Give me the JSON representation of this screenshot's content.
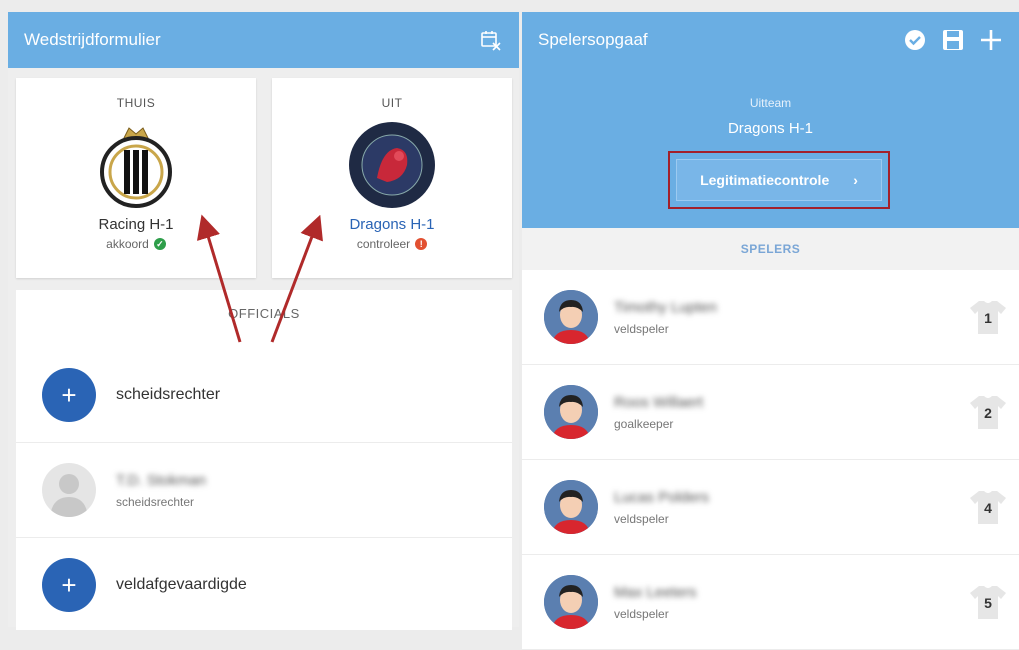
{
  "left_panel": {
    "title": "Wedstrijdformulier",
    "home": {
      "side": "THUIS",
      "name": "Racing H-1",
      "status": "akkoord",
      "status_color": "#2e9e4a"
    },
    "away": {
      "side": "UIT",
      "name": "Dragons H-1",
      "status": "controleer",
      "status_color": "#e25031"
    },
    "officials_title": "OFFICIALS",
    "officials": [
      {
        "type": "add",
        "label": "scheidsrechter"
      },
      {
        "type": "person",
        "name": "T.D. Stokman",
        "role": "scheidsrechter"
      },
      {
        "type": "add",
        "label": "veldafgevaardigde"
      }
    ]
  },
  "right_panel": {
    "title": "Spelersopgaaf",
    "uitteam_label": "Uitteam",
    "team": "Dragons H-1",
    "button_label": "Legitimatiecontrole",
    "button_chevron": "›",
    "spelers_label": "SPELERS",
    "players": [
      {
        "name": "Timothy Lupten",
        "role": "veldspeler",
        "number": "1"
      },
      {
        "name": "Roos Willaert",
        "role": "goalkeeper",
        "number": "2"
      },
      {
        "name": "Lucas Polders",
        "role": "veldspeler",
        "number": "4"
      },
      {
        "name": "Max Leeters",
        "role": "veldspeler",
        "number": "5"
      }
    ]
  },
  "icons": [
    "calendar-remove-icon",
    "verified-icon",
    "save-icon",
    "add-icon",
    "checkmark-icon",
    "exclamation-icon",
    "plus-icon"
  ],
  "colors": {
    "header": "#6aaee3",
    "add_button": "#2a64b5",
    "highlight_border": "#a3202a",
    "arrow": "#b02a2a"
  }
}
